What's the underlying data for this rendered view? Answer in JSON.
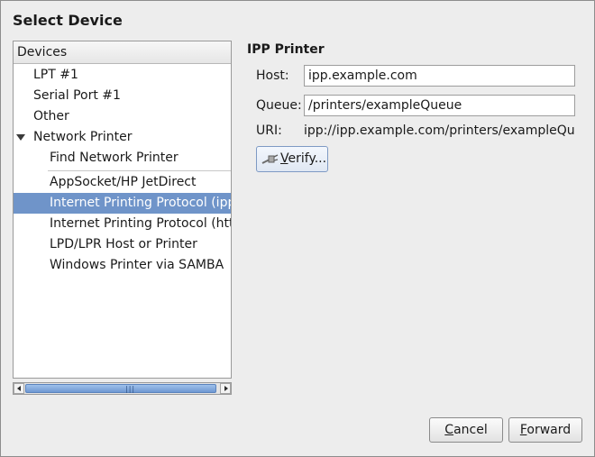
{
  "dialog": {
    "title": "Select Device"
  },
  "devices": {
    "header": "Devices",
    "items": [
      {
        "label": "LPT #1",
        "indent": 0
      },
      {
        "label": "Serial Port #1",
        "indent": 0
      },
      {
        "label": "Other",
        "indent": 0
      },
      {
        "label": "Network Printer",
        "indent": 0,
        "expanded": true
      },
      {
        "label": "Find Network Printer",
        "indent": 1
      },
      {
        "label": "AppSocket/HP JetDirect",
        "indent": 1
      },
      {
        "label": "Internet Printing Protocol (ipp)",
        "indent": 1,
        "selected": true
      },
      {
        "label": "Internet Printing Protocol (https)",
        "indent": 1
      },
      {
        "label": "LPD/LPR Host or Printer",
        "indent": 1
      },
      {
        "label": "Windows Printer via SAMBA",
        "indent": 1
      }
    ],
    "selected_color": "#6f94c9"
  },
  "ipp": {
    "section_title": "IPP Printer",
    "host_label": "Host:",
    "host_value": "ipp.example.com",
    "queue_label": "Queue:",
    "queue_value": "/printers/exampleQueue",
    "uri_label": "URI:",
    "uri_value": "ipp://ipp.example.com/printers/exampleQueue",
    "verify_accel": "V",
    "verify_rest": "erify..."
  },
  "footer": {
    "cancel_accel": "C",
    "cancel_rest": "ancel",
    "forward_accel": "F",
    "forward_rest": "orward"
  }
}
